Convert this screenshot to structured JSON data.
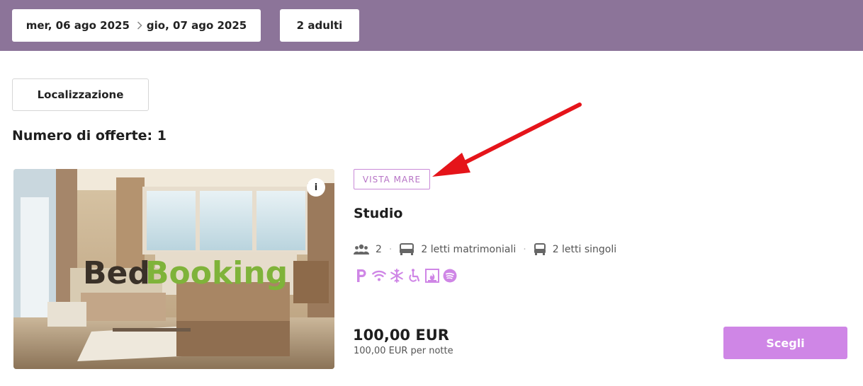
{
  "search": {
    "checkin": "mer, 06 ago 2025",
    "checkout": "gio, 07 ago 2025",
    "guests": "2 adulti"
  },
  "filters": {
    "location_button": "Localizzazione"
  },
  "results": {
    "count_label": "Numero di offerte: 1"
  },
  "offer": {
    "photo_logo_part1": "Bed",
    "photo_logo_part2": "Booking",
    "info_label": "i",
    "badge": "VISTA MARE",
    "name": "Studio",
    "capacity": "2",
    "beds_double": "2 letti matrimoniali",
    "beds_single": "2 letti singoli",
    "amenities": [
      "parking-icon",
      "wifi-icon",
      "air-conditioning-icon",
      "wheelchair-icon",
      "fireplace-icon",
      "spotify-icon"
    ],
    "price": "100,00 EUR",
    "price_per_night": "100,00 EUR per notte",
    "choose_label": "Scegli"
  },
  "colors": {
    "topbar": "#8c7499",
    "accent": "#cf86e6",
    "badge_border": "#c98ad8",
    "annotation_arrow": "#e5141a"
  }
}
